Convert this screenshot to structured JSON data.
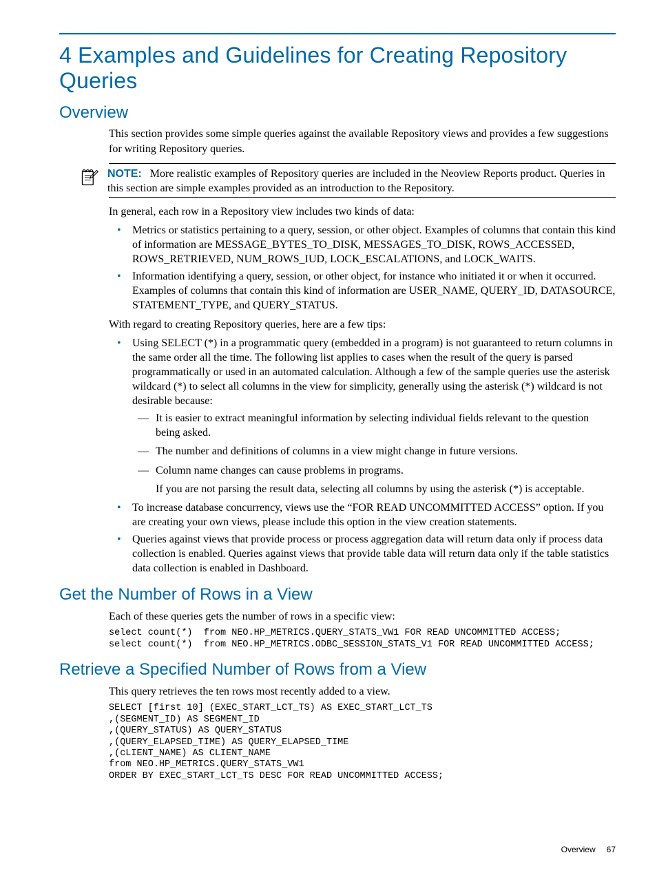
{
  "chapter": {
    "title": "4 Examples and Guidelines for Creating Repository Queries"
  },
  "overview": {
    "heading": "Overview",
    "intro": "This section provides some simple queries against the available Repository views and provides a few suggestions for writing Repository queries.",
    "note": {
      "label": "NOTE:",
      "text": "More realistic examples of Repository queries are included in the Neoview Reports product. Queries in this section are simple examples provided as an introduction to the Repository."
    },
    "para_after_note": "In general, each row in a Repository view includes two kinds of data:",
    "kinds": [
      "Metrics or statistics pertaining to a query, session, or other object. Examples of columns that contain this kind of information are MESSAGE_BYTES_TO_DISK, MESSAGES_TO_DISK, ROWS_ACCESSED, ROWS_RETRIEVED, NUM_ROWS_IUD, LOCK_ESCALATIONS, and LOCK_WAITS.",
      "Information identifying a query, session, or other object, for instance who initiated it or when it occurred. Examples of columns that contain this kind of information are USER_NAME, QUERY_ID, DATASOURCE, STATEMENT_TYPE, and QUERY_STATUS."
    ],
    "tips_intro": "With regard to creating Repository queries, here are a few tips:",
    "tips": {
      "tip1": "Using SELECT (*) in a programmatic query (embedded in a program) is not guaranteed to return columns in the same order all the time. The following list applies to cases when the result of the query is parsed programmatically or used in an automated calculation. Although a few of the sample queries use the asterisk wildcard (*) to select all columns in the view for simplicity, generally using the asterisk (*) wildcard is not desirable because:",
      "tip1_sub": [
        "It is easier to extract meaningful information by selecting individual fields relevant to the question being asked.",
        "The number and definitions of columns in a view might change in future versions.",
        "Column name changes can cause problems in programs."
      ],
      "tip1_after": "If you are not parsing the result data, selecting all columns by using the asterisk (*) is acceptable.",
      "tip2": "To increase database concurrency, views use the “FOR READ UNCOMMITTED ACCESS” option. If you are creating your own views, please include this option in the view creation statements.",
      "tip3": "Queries against views that provide process or process aggregation data will return data only if process data collection is enabled. Queries against views that provide table data will return data only if the table statistics data collection is enabled in Dashboard."
    }
  },
  "section_rows": {
    "heading": "Get the Number of Rows in a View",
    "intro": "Each of these queries gets the number of rows in a specific view:",
    "code": "select count(*)  from NEO.HP_METRICS.QUERY_STATS_VW1 FOR READ UNCOMMITTED ACCESS;\nselect count(*)  from NEO.HP_METRICS.ODBC_SESSION_STATS_V1 FOR READ UNCOMMITTED ACCESS;"
  },
  "section_retrieve": {
    "heading": "Retrieve a Specified Number of Rows from a View",
    "intro": "This query retrieves the ten rows most recently added to a view.",
    "code": "SELECT [first 10] (EXEC_START_LCT_TS) AS EXEC_START_LCT_TS\n,(SEGMENT_ID) AS SEGMENT_ID\n,(QUERY_STATUS) AS QUERY_STATUS\n,(QUERY_ELAPSED_TIME) AS QUERY_ELAPSED_TIME\n,(cLIENT_NAME) AS CLIENT_NAME\nfrom NEO.HP_METRICS.QUERY_STATS_VW1\nORDER BY EXEC_START_LCT_TS DESC FOR READ UNCOMMITTED ACCESS;"
  },
  "footer": {
    "label": "Overview",
    "page": "67"
  }
}
